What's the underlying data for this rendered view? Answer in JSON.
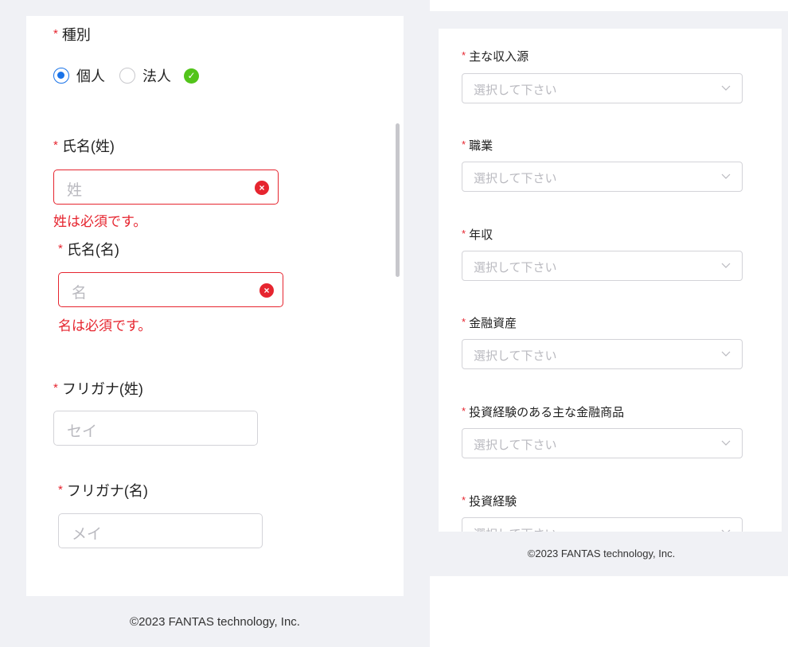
{
  "left": {
    "type_label": "種別",
    "radio_individual": "個人",
    "radio_corporate": "法人",
    "last_name_label": "氏名(姓)",
    "last_name_placeholder": "姓",
    "last_name_error": "姓は必須です。",
    "first_name_label": "氏名(名)",
    "first_name_placeholder": "名",
    "first_name_error": "名は必須です。",
    "kana_last_label": "フリガナ(姓)",
    "kana_last_placeholder": "セイ",
    "kana_first_label": "フリガナ(名)",
    "kana_first_placeholder": "メイ",
    "required_mark": "*",
    "footer": "©2023 FANTAS technology, Inc."
  },
  "right": {
    "fields": [
      {
        "label": "主な収入源",
        "placeholder": "選択して下さい"
      },
      {
        "label": "職業",
        "placeholder": "選択して下さい"
      },
      {
        "label": "年収",
        "placeholder": "選択して下さい"
      },
      {
        "label": "金融資産",
        "placeholder": "選択して下さい"
      },
      {
        "label": "投資経験のある主な金融商品",
        "placeholder": "選択して下さい"
      },
      {
        "label": "投資経験",
        "placeholder": "選択して下さい"
      }
    ],
    "footer": "©2023 FANTAS technology, Inc."
  },
  "colors": {
    "required": "#e6252f",
    "radio_checked": "#1a73e8",
    "valid_check": "#52c41a",
    "background": "#f0f1f5"
  }
}
